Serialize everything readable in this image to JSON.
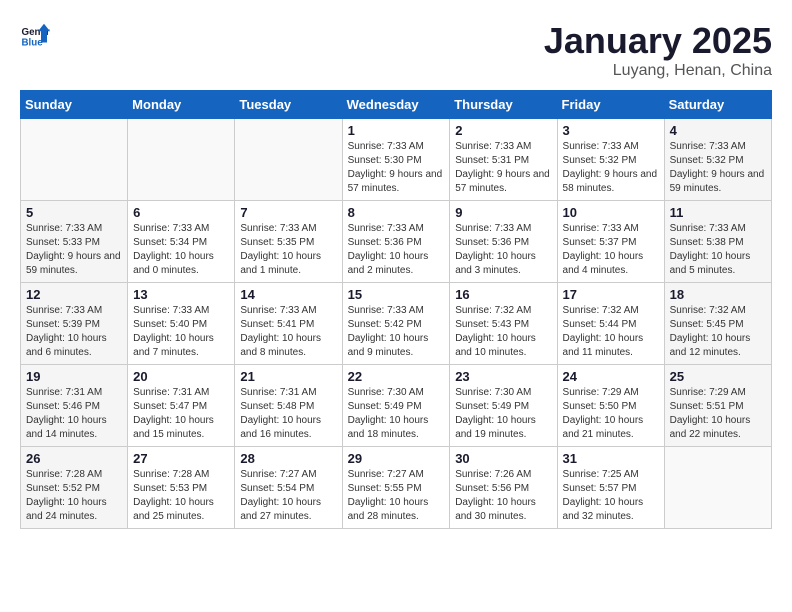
{
  "logo": {
    "line1": "General",
    "line2": "Blue"
  },
  "title": "January 2025",
  "subtitle": "Luyang, Henan, China",
  "weekdays": [
    "Sunday",
    "Monday",
    "Tuesday",
    "Wednesday",
    "Thursday",
    "Friday",
    "Saturday"
  ],
  "weeks": [
    [
      {
        "day": "",
        "info": ""
      },
      {
        "day": "",
        "info": ""
      },
      {
        "day": "",
        "info": ""
      },
      {
        "day": "1",
        "info": "Sunrise: 7:33 AM\nSunset: 5:30 PM\nDaylight: 9 hours and 57 minutes."
      },
      {
        "day": "2",
        "info": "Sunrise: 7:33 AM\nSunset: 5:31 PM\nDaylight: 9 hours and 57 minutes."
      },
      {
        "day": "3",
        "info": "Sunrise: 7:33 AM\nSunset: 5:32 PM\nDaylight: 9 hours and 58 minutes."
      },
      {
        "day": "4",
        "info": "Sunrise: 7:33 AM\nSunset: 5:32 PM\nDaylight: 9 hours and 59 minutes."
      }
    ],
    [
      {
        "day": "5",
        "info": "Sunrise: 7:33 AM\nSunset: 5:33 PM\nDaylight: 9 hours and 59 minutes."
      },
      {
        "day": "6",
        "info": "Sunrise: 7:33 AM\nSunset: 5:34 PM\nDaylight: 10 hours and 0 minutes."
      },
      {
        "day": "7",
        "info": "Sunrise: 7:33 AM\nSunset: 5:35 PM\nDaylight: 10 hours and 1 minute."
      },
      {
        "day": "8",
        "info": "Sunrise: 7:33 AM\nSunset: 5:36 PM\nDaylight: 10 hours and 2 minutes."
      },
      {
        "day": "9",
        "info": "Sunrise: 7:33 AM\nSunset: 5:36 PM\nDaylight: 10 hours and 3 minutes."
      },
      {
        "day": "10",
        "info": "Sunrise: 7:33 AM\nSunset: 5:37 PM\nDaylight: 10 hours and 4 minutes."
      },
      {
        "day": "11",
        "info": "Sunrise: 7:33 AM\nSunset: 5:38 PM\nDaylight: 10 hours and 5 minutes."
      }
    ],
    [
      {
        "day": "12",
        "info": "Sunrise: 7:33 AM\nSunset: 5:39 PM\nDaylight: 10 hours and 6 minutes."
      },
      {
        "day": "13",
        "info": "Sunrise: 7:33 AM\nSunset: 5:40 PM\nDaylight: 10 hours and 7 minutes."
      },
      {
        "day": "14",
        "info": "Sunrise: 7:33 AM\nSunset: 5:41 PM\nDaylight: 10 hours and 8 minutes."
      },
      {
        "day": "15",
        "info": "Sunrise: 7:33 AM\nSunset: 5:42 PM\nDaylight: 10 hours and 9 minutes."
      },
      {
        "day": "16",
        "info": "Sunrise: 7:32 AM\nSunset: 5:43 PM\nDaylight: 10 hours and 10 minutes."
      },
      {
        "day": "17",
        "info": "Sunrise: 7:32 AM\nSunset: 5:44 PM\nDaylight: 10 hours and 11 minutes."
      },
      {
        "day": "18",
        "info": "Sunrise: 7:32 AM\nSunset: 5:45 PM\nDaylight: 10 hours and 12 minutes."
      }
    ],
    [
      {
        "day": "19",
        "info": "Sunrise: 7:31 AM\nSunset: 5:46 PM\nDaylight: 10 hours and 14 minutes."
      },
      {
        "day": "20",
        "info": "Sunrise: 7:31 AM\nSunset: 5:47 PM\nDaylight: 10 hours and 15 minutes."
      },
      {
        "day": "21",
        "info": "Sunrise: 7:31 AM\nSunset: 5:48 PM\nDaylight: 10 hours and 16 minutes."
      },
      {
        "day": "22",
        "info": "Sunrise: 7:30 AM\nSunset: 5:49 PM\nDaylight: 10 hours and 18 minutes."
      },
      {
        "day": "23",
        "info": "Sunrise: 7:30 AM\nSunset: 5:49 PM\nDaylight: 10 hours and 19 minutes."
      },
      {
        "day": "24",
        "info": "Sunrise: 7:29 AM\nSunset: 5:50 PM\nDaylight: 10 hours and 21 minutes."
      },
      {
        "day": "25",
        "info": "Sunrise: 7:29 AM\nSunset: 5:51 PM\nDaylight: 10 hours and 22 minutes."
      }
    ],
    [
      {
        "day": "26",
        "info": "Sunrise: 7:28 AM\nSunset: 5:52 PM\nDaylight: 10 hours and 24 minutes."
      },
      {
        "day": "27",
        "info": "Sunrise: 7:28 AM\nSunset: 5:53 PM\nDaylight: 10 hours and 25 minutes."
      },
      {
        "day": "28",
        "info": "Sunrise: 7:27 AM\nSunset: 5:54 PM\nDaylight: 10 hours and 27 minutes."
      },
      {
        "day": "29",
        "info": "Sunrise: 7:27 AM\nSunset: 5:55 PM\nDaylight: 10 hours and 28 minutes."
      },
      {
        "day": "30",
        "info": "Sunrise: 7:26 AM\nSunset: 5:56 PM\nDaylight: 10 hours and 30 minutes."
      },
      {
        "day": "31",
        "info": "Sunrise: 7:25 AM\nSunset: 5:57 PM\nDaylight: 10 hours and 32 minutes."
      },
      {
        "day": "",
        "info": ""
      }
    ]
  ]
}
